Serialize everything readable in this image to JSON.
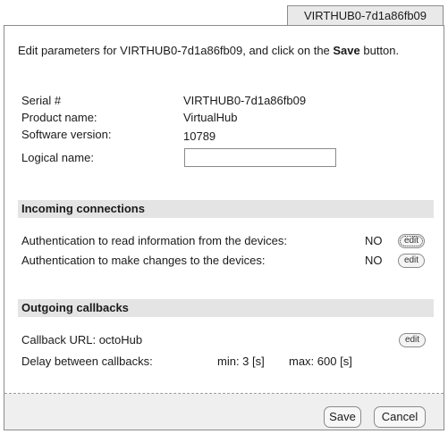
{
  "tab": {
    "title": "VIRTHUB0-7d1a86fb09"
  },
  "intro": {
    "text_before": "Edit parameters for VIRTHUB0-7d1a86fb09, and click on the ",
    "bold": "Save",
    "text_after": " button."
  },
  "info": {
    "serial_label": "Serial #",
    "serial_value": "VIRTHUB0-7d1a86fb09",
    "product_label": "Product name:",
    "product_value": "VirtualHub",
    "software_label": "Software version:",
    "software_value": "10789",
    "logical_label": "Logical name:",
    "logical_value": ""
  },
  "incoming": {
    "heading": "Incoming connections",
    "auth_read_label": "Authentication to read information from the devices:",
    "auth_read_value": "NO",
    "auth_write_label": "Authentication to make changes to the devices:",
    "auth_write_value": "NO",
    "edit_label": "edit"
  },
  "outgoing": {
    "heading": "Outgoing callbacks",
    "callback_url_label": "Callback URL: octoHub",
    "delay_label": "Delay between callbacks:",
    "delay_min": "min: 3 [s]",
    "delay_max": "max: 600 [s]",
    "edit_label": "edit"
  },
  "buttons": {
    "save": "Save",
    "cancel": "Cancel"
  }
}
